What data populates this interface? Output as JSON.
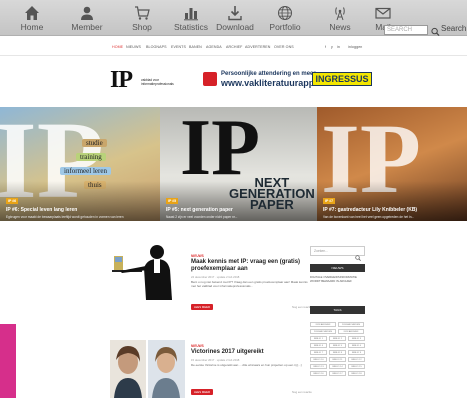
{
  "toolbar": {
    "items": [
      {
        "label": "Home",
        "icon": "home-icon"
      },
      {
        "label": "Member",
        "icon": "member-icon"
      },
      {
        "label": "Shop",
        "icon": "cart-icon"
      },
      {
        "label": "Statistics",
        "icon": "statistics-icon"
      },
      {
        "label": "Download",
        "icon": "download-icon"
      },
      {
        "label": "Portfolio",
        "icon": "globe-icon"
      },
      {
        "label": "News",
        "icon": "antenna-icon"
      },
      {
        "label": "Mail",
        "icon": "mail-icon"
      }
    ],
    "search_placeholder": "SEARCH",
    "search_label": "Search"
  },
  "site_nav": {
    "items": [
      "HOME",
      "NIEUWS",
      "BLOGNAPS",
      "EVENTS",
      "BANEN",
      "AGENDA",
      "ARCHIEF",
      "ADVERTEREN",
      "OVER ONS",
      "inloggen"
    ],
    "social": [
      "f",
      "y",
      "in"
    ]
  },
  "header": {
    "logo": "IP",
    "logo_sub": "vakblad voor informatieprofessionals",
    "banner_line1": "Persoonlijke attendering en meer",
    "banner_line2": "www.vakliteratuurapp.info",
    "banner_brand": "INGRESSUS"
  },
  "slider": {
    "slides": [
      {
        "tag": "IP #6",
        "title": "IP #6: Special leven lang leren",
        "desc": "Egbrugen voor maakt de bewaarplaats leeftijd wordt gehouden in vormen van leren"
      },
      {
        "tag": "IP #5",
        "title": "IP #5: next generation paper",
        "desc": "Naast 2 zijn er veel voorden onder nicht paper nr..."
      },
      {
        "tag": "IP #7",
        "title": "IP #7: gastredacteur Lily Knibbeler (KB)",
        "desc": "Van de bovenkant van heel het veel geen opgetreden de het in..."
      }
    ],
    "signs": [
      "studie",
      "training",
      "informeel leren",
      "thuis"
    ],
    "next_gen": [
      "NEXT",
      "GENERATION",
      "PAPER"
    ]
  },
  "posts": [
    {
      "category": "NIEUWS",
      "title": "Maak kennis met IP: vraag een (gratis) proefexemplaar aan",
      "meta": "24 december 2017 · update 2 feb 2018",
      "excerpt": "Bent u nog niet bekend met IP? Vraag dan een gratis proefexemplaar aan! Maak kennis met het vakblad voor informatieprofessionals...",
      "button": "LEES MEER",
      "comments": "Nog een reactie"
    },
    {
      "category": "NIEUWS",
      "title": "Victorines 2017 uitgereikt",
      "meta": "15 december 2017 · update 2 feb 2018",
      "excerpt": "De eerste Victorine is uitgereikt aan ... Alle winnaars en hun projecten op een rij [...]",
      "button": "LEES MEER",
      "comments": "Nog een reactie"
    }
  ],
  "sidebar": {
    "search_placeholder": "Zoeken...",
    "head1": "NIEUWS",
    "text1": "DIGITALE OVERHEIDSINFORMATIE WORDT BEWAARD IN ARCHIEF",
    "head2": "TAGS",
    "tags": [
      "2018 ARCHIEF",
      "2018 ARCHIEVEN",
      "2018 ARCHIEVEN",
      "2018 ARCHIEF",
      "BIBLIO 1",
      "BIBLIO 2",
      "BIBLIO 3",
      "BIBLIO 4",
      "BIBLIO 5",
      "BIBLIO 6",
      "BIBLIO 7",
      "BIBLIO 8",
      "BIBLIO 9",
      "BIBLIO 10",
      "BIBLIO 11",
      "BIBLIO 12",
      "BIBLIO 13",
      "BIBLIO 14",
      "BIBLIO 15",
      "BIBLIO 16",
      "BIBLIO 17",
      "BIBLIO 18"
    ]
  },
  "colors": {
    "accent": "#d62128",
    "brand_blue": "#1b365d",
    "ingressus_yellow": "#f3e600",
    "slide_tag": "#e8a317",
    "left_strip": "#d62f8b"
  }
}
